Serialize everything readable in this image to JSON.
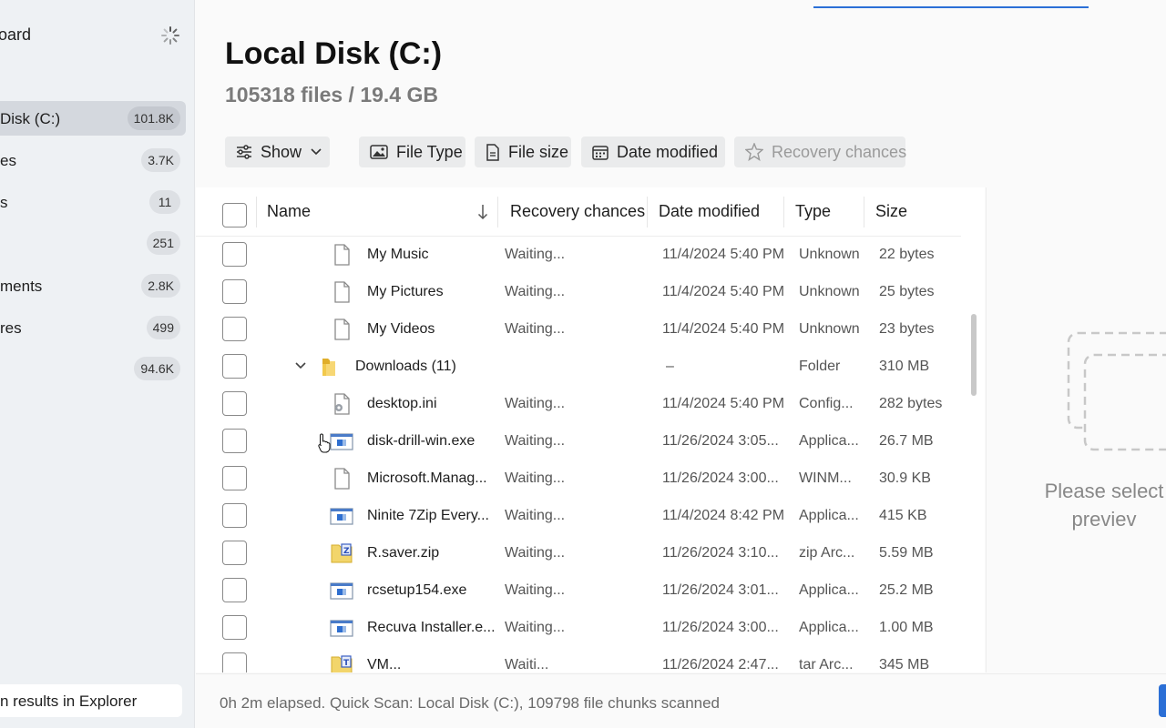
{
  "sidebar": {
    "title": "oard",
    "items": [
      {
        "label": "Disk (C:)",
        "count": "101.8K",
        "active": true
      },
      {
        "label": "es",
        "count": "3.7K"
      },
      {
        "label": "s",
        "count": "11"
      },
      {
        "label": "",
        "count": "251"
      },
      {
        "label": "ments",
        "count": "2.8K"
      },
      {
        "label": "res",
        "count": "499"
      },
      {
        "label": "",
        "count": "94.6K"
      }
    ],
    "bottom_label": "n results in Explorer"
  },
  "header": {
    "title": "Local Disk (C:)",
    "subtitle": "105318 files / 19.4 GB"
  },
  "filters": {
    "show": "Show",
    "file_type": "File Type",
    "file_size": "File size",
    "date_modified": "Date modified",
    "recovery_chances": "Recovery chances"
  },
  "table": {
    "columns": {
      "name": "Name",
      "recovery": "Recovery chances",
      "date": "Date modified",
      "type": "Type",
      "size": "Size"
    },
    "rows": [
      {
        "name": "My Music",
        "recovery": "Waiting...",
        "date": "11/4/2024 5:40 PM",
        "type": "Unknown",
        "size": "22 bytes",
        "icon": "file-icon"
      },
      {
        "name": "My Pictures",
        "recovery": "Waiting...",
        "date": "11/4/2024 5:40 PM",
        "type": "Unknown",
        "size": "25 bytes",
        "icon": "file-icon"
      },
      {
        "name": "My Videos",
        "recovery": "Waiting...",
        "date": "11/4/2024 5:40 PM",
        "type": "Unknown",
        "size": "23 bytes",
        "icon": "file-icon"
      },
      {
        "name": "Downloads (11)",
        "recovery": "",
        "date": "–",
        "type": "Folder",
        "size": "310 MB",
        "icon": "folder-icon"
      },
      {
        "name": "desktop.ini",
        "recovery": "Waiting...",
        "date": "11/4/2024 5:40 PM",
        "type": "Config...",
        "size": "282 bytes",
        "icon": "config-file-icon"
      },
      {
        "name": "disk-drill-win.exe",
        "recovery": "Waiting...",
        "date": "11/26/2024 3:05...",
        "type": "Applica...",
        "size": "26.7 MB",
        "icon": "application-icon"
      },
      {
        "name": "Microsoft.Manag...",
        "recovery": "Waiting...",
        "date": "11/26/2024 3:00...",
        "type": "WINM...",
        "size": "30.9 KB",
        "icon": "file-icon"
      },
      {
        "name": "Ninite 7Zip Every...",
        "recovery": "Waiting...",
        "date": "11/4/2024 8:42 PM",
        "type": "Applica...",
        "size": "415 KB",
        "icon": "application-icon"
      },
      {
        "name": "R.saver.zip",
        "recovery": "Waiting...",
        "date": "11/26/2024 3:10...",
        "type": "zip Arc...",
        "size": "5.59 MB",
        "icon": "zip-archive-icon"
      },
      {
        "name": "rcsetup154.exe",
        "recovery": "Waiting...",
        "date": "11/26/2024 3:01...",
        "type": "Applica...",
        "size": "25.2 MB",
        "icon": "application-icon"
      },
      {
        "name": "Recuva Installer.e...",
        "recovery": "Waiting...",
        "date": "11/26/2024 3:00...",
        "type": "Applica...",
        "size": "1.00 MB",
        "icon": "application-icon"
      },
      {
        "name": "VM...",
        "recovery": "Waiti...",
        "date": "11/26/2024 2:47...",
        "type": "tar Arc...",
        "size": "345 MB",
        "icon": "tar-archive-icon"
      }
    ]
  },
  "preview": {
    "line1": "Please select",
    "line2": "previev"
  },
  "status": {
    "text": "0h 2m elapsed. Quick Scan: Local Disk (C:), 109798 file chunks scanned"
  },
  "colors": {
    "accent": "#2b6fd6",
    "sidebar_bg": "#eef1f4",
    "active_item": "#d4d8de"
  }
}
